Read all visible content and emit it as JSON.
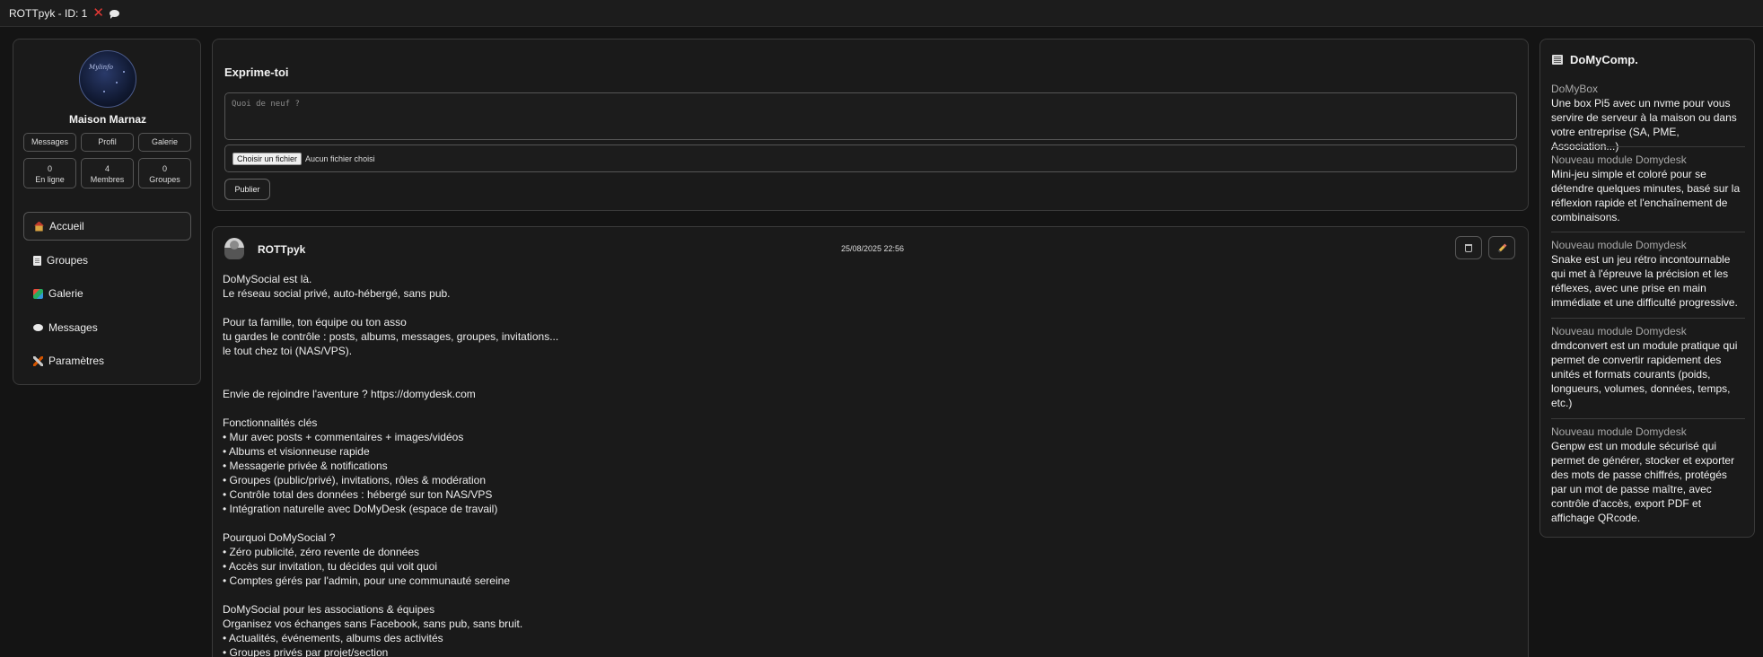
{
  "window": {
    "title": "ROTTpyk - ID: 1"
  },
  "profile": {
    "name": "Maison Marnaz",
    "avatar_text": "Mylinfo",
    "buttons": [
      "Messages",
      "Profil",
      "Galerie"
    ],
    "stats": [
      {
        "value": "0",
        "label": "En ligne"
      },
      {
        "value": "4",
        "label": "Membres"
      },
      {
        "value": "0",
        "label": "Groupes"
      }
    ]
  },
  "nav": {
    "items": [
      {
        "label": "Accueil",
        "icon": "home-icon",
        "active": true
      },
      {
        "label": "Groupes",
        "icon": "document-icon"
      },
      {
        "label": "Galerie",
        "icon": "gallery-icon"
      },
      {
        "label": "Messages",
        "icon": "speech-bubble-icon"
      },
      {
        "label": "Paramètres",
        "icon": "tools-icon"
      }
    ]
  },
  "composer": {
    "title": "Exprime-toi",
    "placeholder": "Quoi de neuf ?",
    "choose_file": "Choisir un fichier",
    "no_file": "Aucun fichier choisi",
    "publish": "Publier"
  },
  "post": {
    "author": "ROTTpyk",
    "date": "25/08/2025 22:56",
    "body": "DoMySocial est là.\nLe réseau social privé, auto-hébergé, sans pub.\n\nPour ta famille, ton équipe ou ton asso\ntu gardes le contrôle : posts, albums, messages, groupes, invitations...\nle tout chez toi (NAS/VPS).\n\n\nEnvie de rejoindre l'aventure ? https://domydesk.com\n\nFonctionnalités clés\n• Mur avec posts + commentaires + images/vidéos\n• Albums et visionneuse rapide\n• Messagerie privée & notifications\n• Groupes (public/privé), invitations, rôles & modération\n• Contrôle total des données : hébergé sur ton NAS/VPS\n• Intégration naturelle avec DoMyDesk (espace de travail)\n\nPourquoi DoMySocial ?\n• Zéro publicité, zéro revente de données\n• Accès sur invitation, tu décides qui voit quoi\n• Comptes gérés par l'admin, pour une communauté sereine\n\nDoMySocial pour les associations & équipes\nOrganisez vos échanges sans Facebook, sans pub, sans bruit.\n• Actualités, événements, albums des activités\n• Groupes privés par projet/section"
  },
  "sidebar_right": {
    "title": "DoMyComp.",
    "items": [
      {
        "title": "DoMyBox",
        "desc": "Une box Pi5 avec un nvme pour vous servire de serveur à la maison ou dans votre entreprise (SA, PME, Association...)"
      },
      {
        "title": "Nouveau module Domydesk",
        "desc": "Mini-jeu simple et coloré pour se détendre quelques minutes, basé sur la réflexion rapide et l'enchaînement de combinaisons."
      },
      {
        "title": "Nouveau module Domydesk",
        "desc": "Snake est un jeu rétro incontournable qui met à l'épreuve la précision et les réflexes, avec une prise en main immédiate et une difficulté progressive."
      },
      {
        "title": "Nouveau module Domydesk",
        "desc": "dmdconvert est un module pratique qui permet de convertir rapidement des unités et formats courants (poids, longueurs, volumes, données, temps, etc.)"
      },
      {
        "title": "Nouveau module Domydesk",
        "desc": "Genpw est un module sécurisé qui permet de générer, stocker et exporter des mots de passe chiffrés, protégés par un mot de passe maître, avec contrôle d'accès, export PDF et affichage QRcode."
      }
    ]
  },
  "colors": {
    "background": "#141414",
    "panel": "#1a1a1a",
    "border": "#3a3a3a",
    "close_red": "#e53935"
  }
}
